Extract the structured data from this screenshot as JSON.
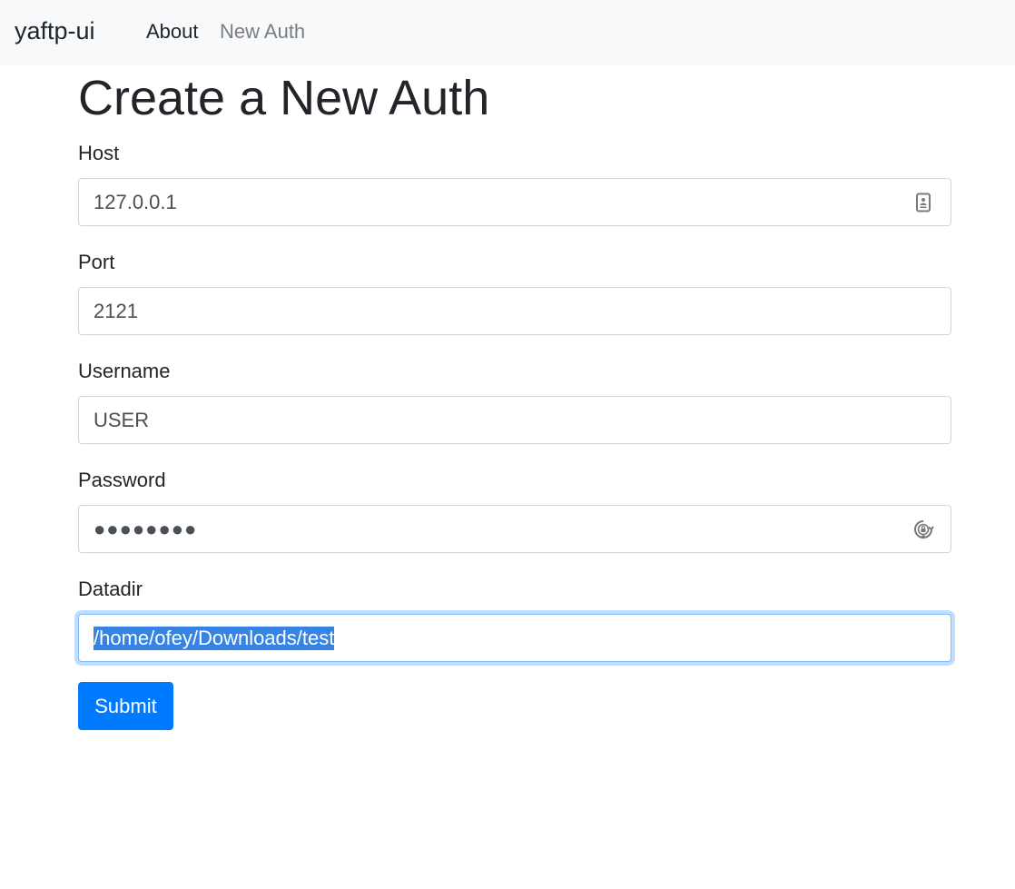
{
  "navbar": {
    "brand": "yaftp-ui",
    "links": [
      {
        "label": "About",
        "active": true
      },
      {
        "label": "New Auth",
        "active": false
      }
    ]
  },
  "page": {
    "title": "Create a New Auth"
  },
  "form": {
    "host": {
      "label": "Host",
      "value": "127.0.0.1",
      "icon": "contact-card-autofill-icon"
    },
    "port": {
      "label": "Port",
      "value": "2121"
    },
    "username": {
      "label": "Username",
      "value": "USER"
    },
    "password": {
      "label": "Password",
      "value": "●●●●●●●●",
      "icon": "password-key-icon"
    },
    "datadir": {
      "label": "Datadir",
      "value": "/home/ofey/Downloads/test",
      "focused": true,
      "selected": true
    },
    "submit_label": "Submit"
  },
  "colors": {
    "navbar_bg": "#f8f9fa",
    "primary": "#007bff",
    "selection": "#3584e4",
    "focus_border": "#80bdff",
    "muted_link": "#7a7d80"
  }
}
